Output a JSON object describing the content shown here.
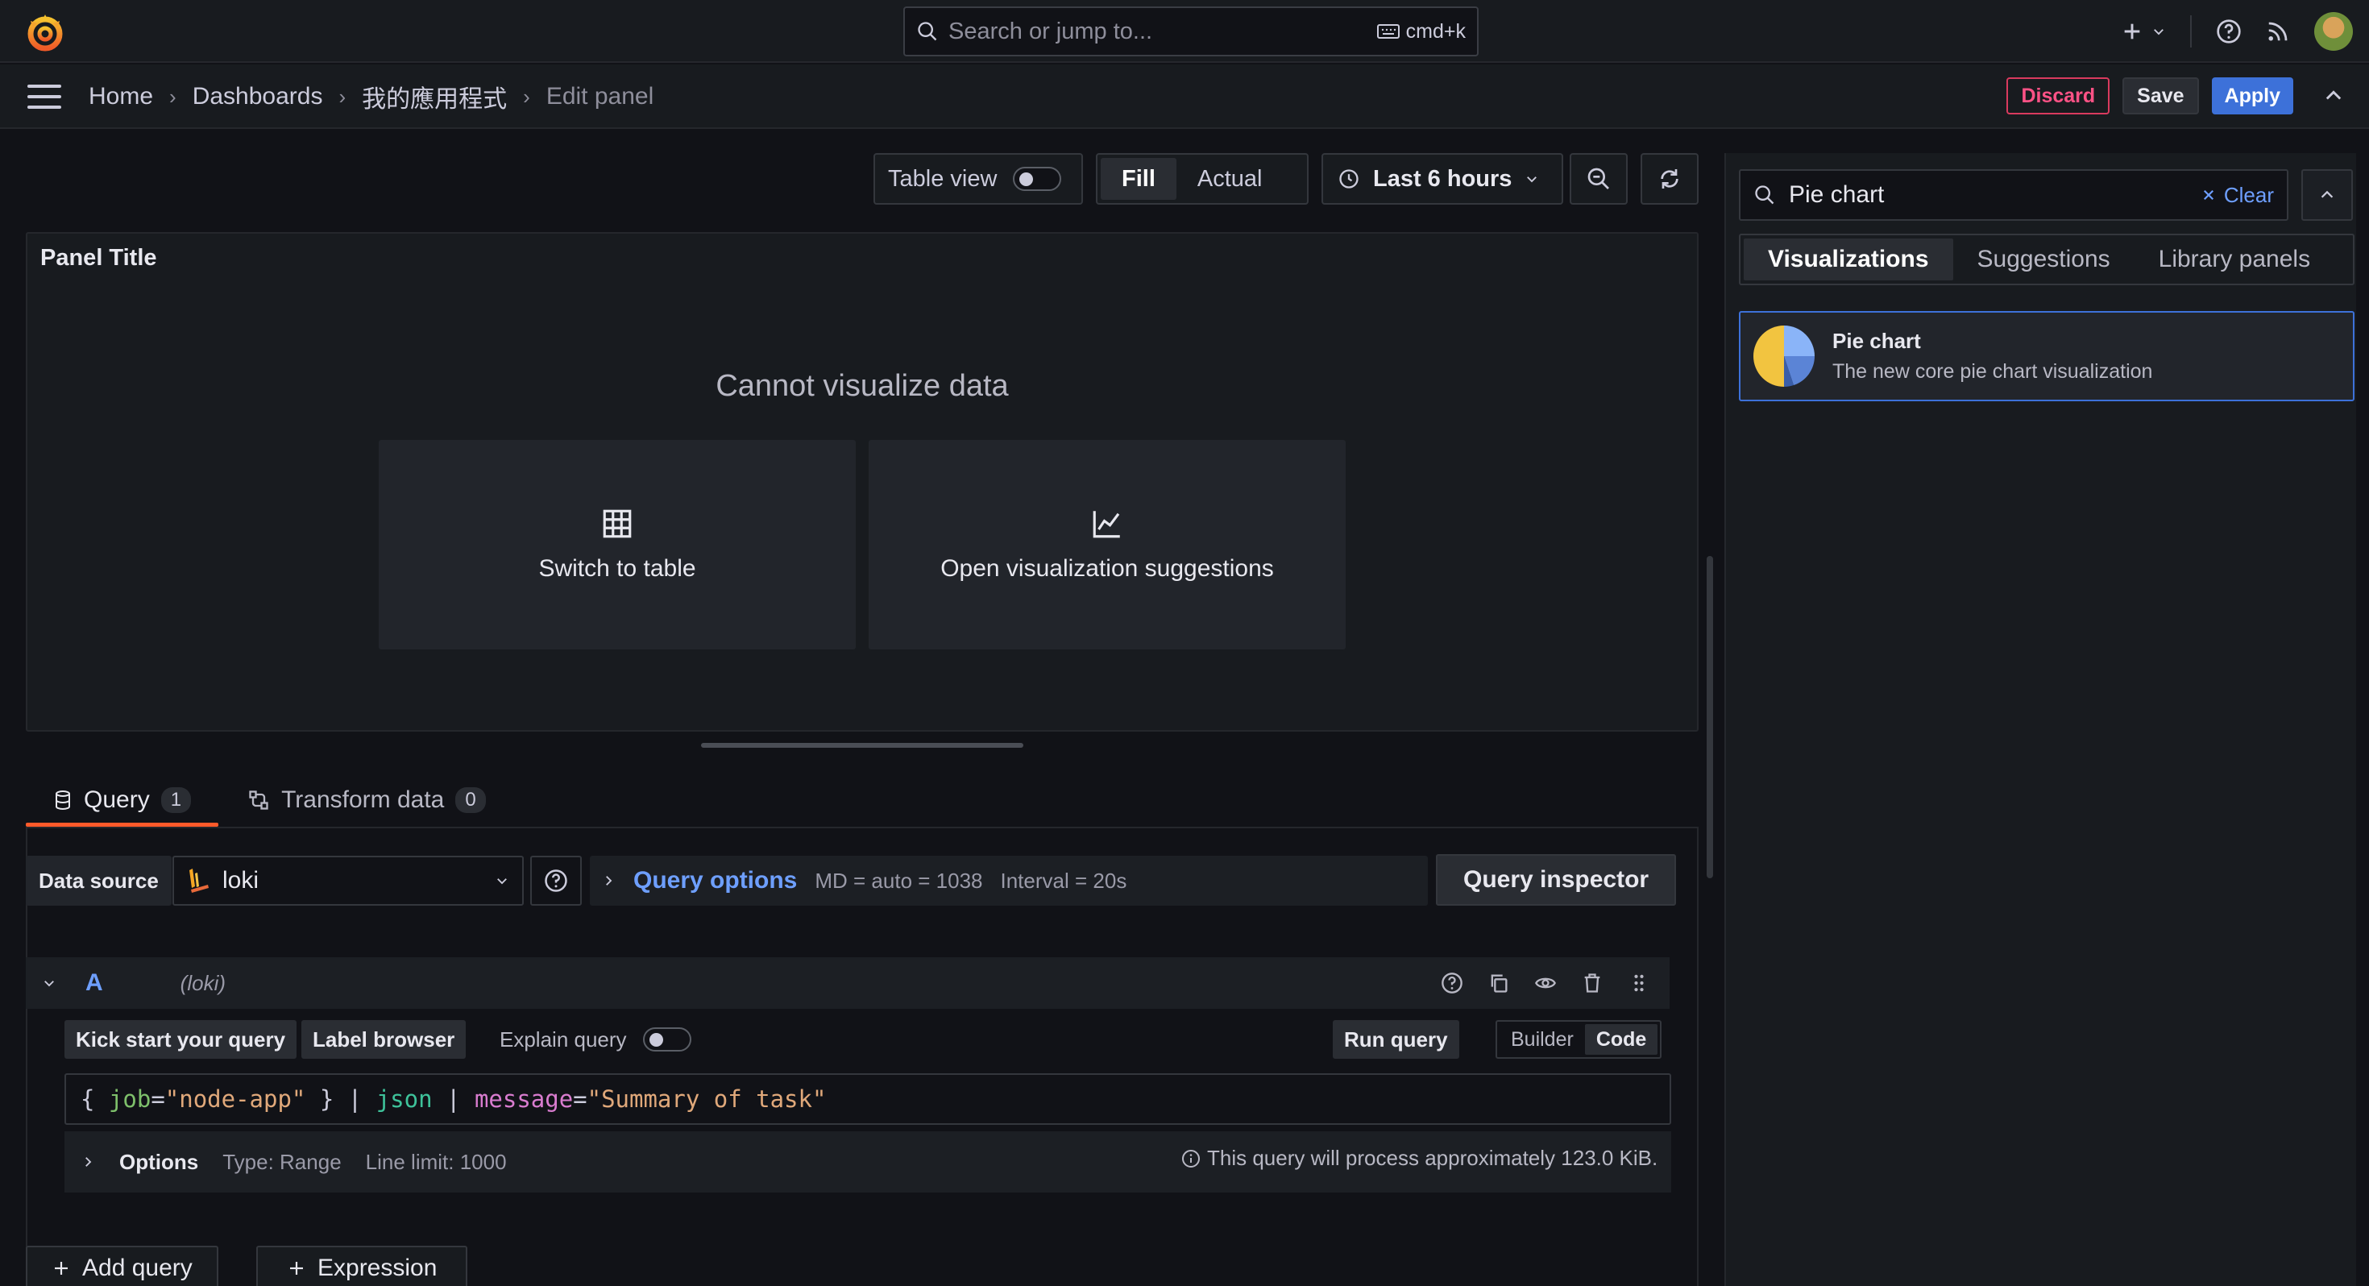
{
  "topbar": {
    "search_placeholder": "Search or jump to...",
    "search_shortcut": "cmd+k",
    "icons": [
      "grafana-logo-icon",
      "plus-icon",
      "help-icon",
      "news-rss-icon",
      "avatar"
    ]
  },
  "breadcrumb": {
    "items": [
      "Home",
      "Dashboards",
      "我的應用程式",
      "Edit panel"
    ]
  },
  "actions": {
    "discard": "Discard",
    "save": "Save",
    "apply": "Apply"
  },
  "toolbar": {
    "table_view": "Table view",
    "fill": "Fill",
    "actual": "Actual",
    "time_range": "Last 6 hours"
  },
  "panel": {
    "title": "Panel Title",
    "message": "Cannot visualize data",
    "switch_to_table": "Switch to table",
    "open_suggestions": "Open visualization suggestions"
  },
  "tabs": {
    "query": {
      "label": "Query",
      "count": "1"
    },
    "transform": {
      "label": "Transform data",
      "count": "0"
    }
  },
  "datasource": {
    "label": "Data source",
    "value": "loki",
    "query_options": "Query options",
    "md": "MD = auto = 1038",
    "interval": "Interval = 20s",
    "inspector": "Query inspector"
  },
  "query_row": {
    "ref_id": "A",
    "ds_name": "(loki)",
    "kick_start": "Kick start your query",
    "label_browser": "Label browser",
    "explain": "Explain query",
    "run_query": "Run query",
    "builder": "Builder",
    "code": "Code",
    "code_parts": {
      "p1": "{ ",
      "label": "job",
      "eq1": "=",
      "val1": "\"node-app\"",
      "p2": " } | ",
      "fn": "json",
      "p3": " | ",
      "key": "message",
      "eq2": "=",
      "val2": "\"Summary of task\""
    },
    "options": "Options",
    "type": "Type: Range",
    "line_limit": "Line limit: 1000",
    "process_info": "This query will process approximately 123.0 KiB."
  },
  "bottom": {
    "add_query": "Add query",
    "expression": "Expression"
  },
  "viz_picker": {
    "search_value": "Pie chart",
    "clear": "Clear",
    "tabs": [
      "Visualizations",
      "Suggestions",
      "Library panels"
    ],
    "result_title": "Pie chart",
    "result_desc": "The new core pie chart visualization"
  },
  "colors": {
    "accent_blue": "#3d71d9",
    "discard_red": "#d93a5e",
    "tab_underline": "#ff5a2a",
    "link_blue": "#6e9fff"
  }
}
